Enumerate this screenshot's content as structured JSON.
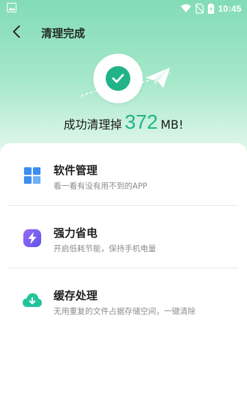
{
  "status_bar": {
    "time": "10:45",
    "icons": [
      "gallery-icon",
      "wifi-icon",
      "no-sim-icon",
      "battery-charging-icon"
    ]
  },
  "app_bar": {
    "title": "清理完成",
    "back_icon": "back-arrow-icon"
  },
  "result": {
    "prefix": "成功清理掉",
    "amount": "372",
    "unit": "MB!"
  },
  "items": [
    {
      "title": "软件管理",
      "desc": "看一看有没有用不到的APP",
      "icon": "app-grid-icon",
      "color": "#3d8ef0"
    },
    {
      "title": "强力省电",
      "desc": "开启低耗节能，保持手机电量",
      "icon": "lightning-icon",
      "color": "#7b5cf0"
    },
    {
      "title": "缓存处理",
      "desc": "无用重复的文件占据存储空间，一键清除",
      "icon": "cloud-download-icon",
      "color": "#22c49b"
    }
  ],
  "colors": {
    "accent": "#1fb487",
    "header_green": "#82dcb5"
  }
}
